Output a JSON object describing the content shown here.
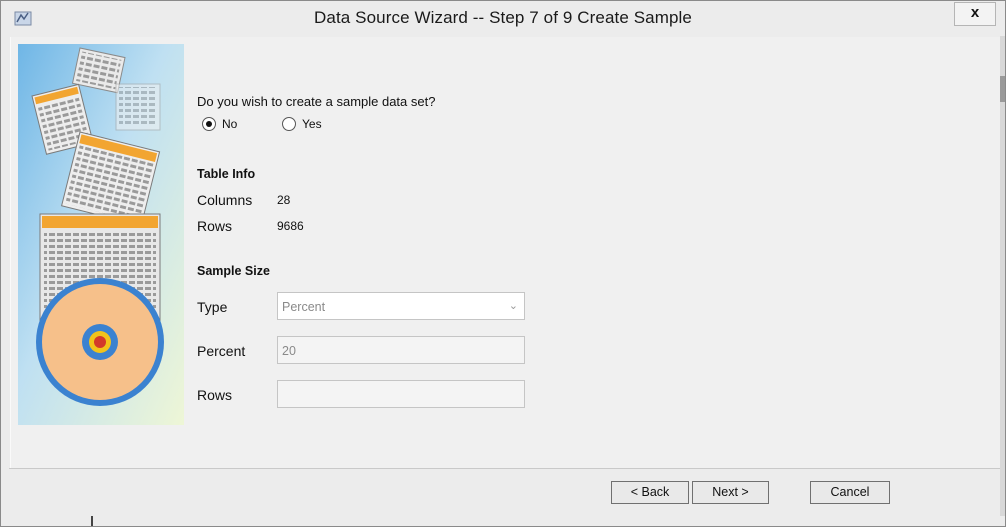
{
  "window": {
    "title": "Data Source Wizard  -- Step 7 of 9  Create Sample",
    "close_label": "x"
  },
  "question": "Do you wish to create a sample data set?",
  "sample_choice": {
    "options": [
      "No",
      "Yes"
    ],
    "selected": "No"
  },
  "table_info": {
    "heading": "Table Info",
    "columns_label": "Columns",
    "columns_value": "28",
    "rows_label": "Rows",
    "rows_value": "9686"
  },
  "sample_size": {
    "heading": "Sample Size",
    "type_label": "Type",
    "type_value": "Percent",
    "percent_label": "Percent",
    "percent_value": "20",
    "rows_label": "Rows",
    "rows_value": ""
  },
  "buttons": {
    "back": "< Back",
    "next": "Next >",
    "cancel": "Cancel"
  },
  "colors": {
    "accent_orange": "#f2a531",
    "target_blue": "#3b82d0",
    "target_peach": "#f6c08a"
  }
}
